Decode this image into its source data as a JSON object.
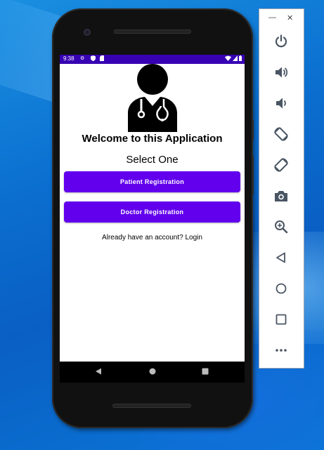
{
  "statusbar": {
    "time": "9:38",
    "left_icons": [
      "settings-icon",
      "shield-icon",
      "sd-card-icon"
    ],
    "right_icons": [
      "wifi-icon",
      "signal-icon",
      "battery-icon"
    ],
    "color": "#3700B3"
  },
  "app": {
    "welcome_title": "Welcome to this Application",
    "select_prompt": "Select One",
    "patient_button": "Patient Registration",
    "doctor_button": "Doctor Registration",
    "login_prompt": "Already have an account? Login",
    "button_color": "#6200EE",
    "logo_icon": "doctor-stethoscope-icon"
  },
  "navbar": {
    "icons": [
      "back-icon",
      "home-icon",
      "recent-apps-icon"
    ]
  },
  "emulator_toolbar": {
    "window_controls": [
      "minimize-icon",
      "close-icon"
    ],
    "tools": [
      "power-icon",
      "volume-up-icon",
      "volume-down-icon",
      "rotate-left-icon",
      "rotate-right-icon",
      "screenshot-icon",
      "zoom-icon",
      "back-icon",
      "home-icon",
      "overview-icon",
      "more-icon"
    ]
  }
}
